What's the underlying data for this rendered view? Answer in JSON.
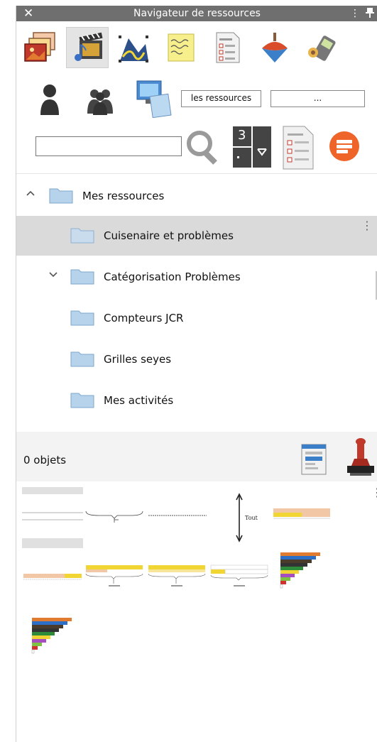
{
  "window": {
    "title": "Navigateur de ressources",
    "close_glyph": "✕",
    "menu_glyph": "⋮"
  },
  "category_tabs": [
    {
      "icon": "pictures-icon",
      "active": false
    },
    {
      "icon": "media-icon",
      "active": true
    },
    {
      "icon": "drawing-icon",
      "active": false
    },
    {
      "icon": "sticky-note-icon",
      "active": false
    },
    {
      "icon": "form-document-icon",
      "active": false
    },
    {
      "icon": "spinning-top-icon",
      "active": false
    },
    {
      "icon": "device-icon",
      "active": false
    }
  ],
  "filters": {
    "scope_field": "les ressources",
    "extra_field": "..."
  },
  "search": {
    "value": "",
    "placeholder": "",
    "keypad_top": "3"
  },
  "tree": {
    "root": {
      "label": "Mes ressources",
      "expanded": true
    },
    "children": [
      {
        "label": "Cuisenaire et problèmes",
        "selected": true
      },
      {
        "label": "Catégorisation Problèmes",
        "collapsed_chevron": true
      },
      {
        "label": "Compteurs JCR"
      },
      {
        "label": "Grilles seyes"
      },
      {
        "label": "Mes activités"
      }
    ]
  },
  "objects": {
    "count_label": "0 objets",
    "tout_label": "Tout"
  },
  "colors": {
    "titlebar": "#6f6f6f",
    "selected_row": "#dadada",
    "folder": "#b7d3ec",
    "orange_button": "#ef6428",
    "bar_yellow": "#f1d633",
    "bar_peach": "#f2c7a5"
  }
}
